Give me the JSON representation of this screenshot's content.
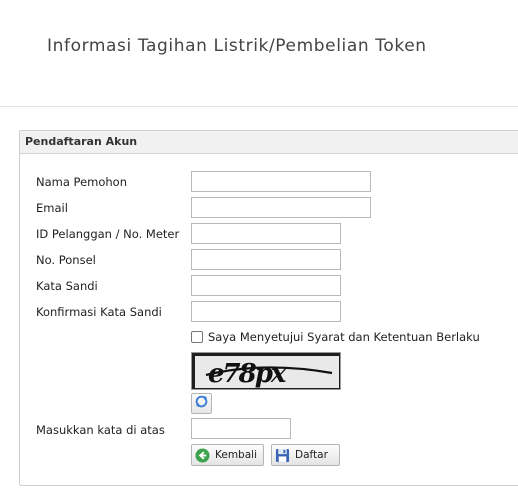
{
  "header": {
    "title": "Informasi Tagihan Listrik/Pembelian Token"
  },
  "panel": {
    "heading": "Pendaftaran Akun",
    "fields": [
      {
        "label": "Nama Pemohon",
        "value": "",
        "placeholder": ""
      },
      {
        "label": "Email",
        "value": "",
        "placeholder": ""
      },
      {
        "label": "ID Pelanggan / No. Meter",
        "value": "",
        "placeholder": ""
      },
      {
        "label": "No. Ponsel",
        "value": "",
        "placeholder": ""
      },
      {
        "label": "Kata Sandi",
        "value": "",
        "placeholder": ""
      },
      {
        "label": "Konfirmasi Kata Sandi",
        "value": "",
        "placeholder": ""
      }
    ],
    "agree": {
      "label": "Saya Menyetujui Syarat dan Ketentuan Berlaku",
      "checked": false
    },
    "captcha": {
      "text": "e78px",
      "input_label": "Masukkan kata di atas",
      "value": ""
    },
    "buttons": {
      "back_label": "Kembali",
      "register_label": "Daftar"
    }
  },
  "icons": {
    "refresh": "refresh-icon",
    "back": "back-arrow-icon",
    "register": "save-disk-icon"
  }
}
